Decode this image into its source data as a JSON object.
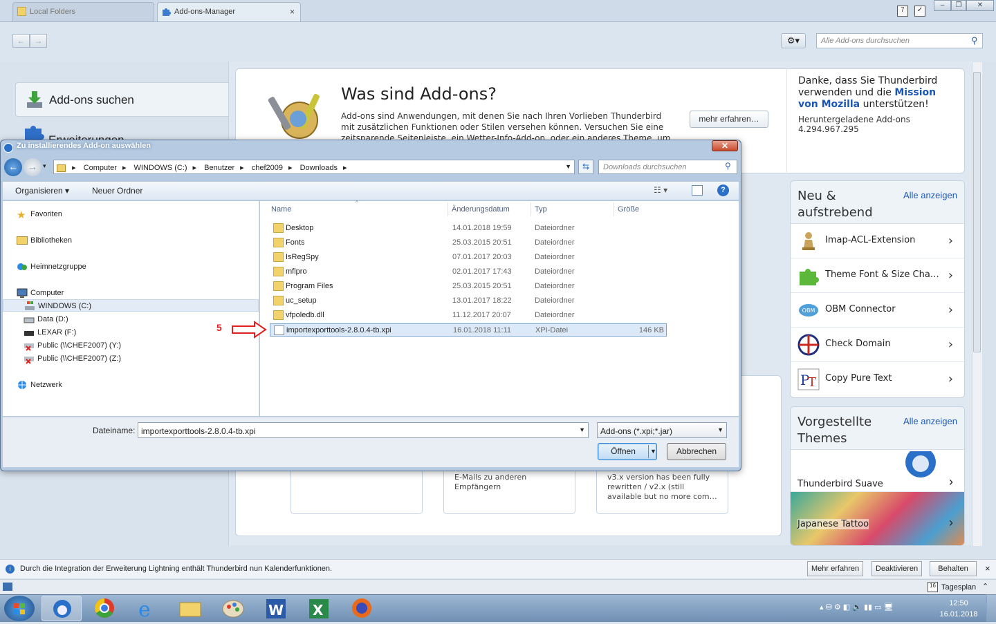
{
  "window": {
    "tabs": [
      {
        "label": "Local Folders"
      },
      {
        "label": "Add-ons-Manager",
        "close": "×"
      }
    ],
    "nav_back": "←",
    "nav_forward": "→",
    "search_placeholder": "Alle Add-ons durchsuchen"
  },
  "sidebar": {
    "items": [
      {
        "label": "Add-ons suchen",
        "icon": "download-icon"
      },
      {
        "label": "Erweiterungen",
        "icon": "puzzle-icon"
      }
    ]
  },
  "whatis": {
    "title": "Was sind Add-ons?",
    "description": "Add-ons sind Anwendungen, mit denen Sie nach Ihren Vorlieben Thunderbird mit zusätzlichen Funktionen oder Stilen versehen können. Versuchen Sie eine zeitsparende Seitenleiste, ein Wetter-Info-Add-on, oder ein anderes Theme, um",
    "more_button": "mehr erfahren…"
  },
  "thanks": {
    "line1": "Danke, dass Sie Thunderbird verwenden und die",
    "link": "Mission von Mozilla",
    "line2": "unterstützen!",
    "downloaded_label": "Heruntergeladene Add-ons",
    "downloaded_count": "4.294.967.295"
  },
  "rising": {
    "title": "Neu & aufstrebend",
    "show_all": "Alle anzeigen",
    "items": [
      {
        "label": "Imap-ACL-Extension",
        "icon": "chess-pawn-icon"
      },
      {
        "label": "Theme Font & Size Cha…",
        "icon": "puzzle-green-icon"
      },
      {
        "label": "OBM Connector",
        "icon": "obm-icon"
      },
      {
        "label": "Check Domain",
        "icon": "globe-icon"
      },
      {
        "label": "Copy Pure Text",
        "icon": "pt-logo-icon"
      }
    ]
  },
  "themes": {
    "title": "Vorgestellte Themes",
    "show_all": "Alle anzeigen",
    "items": [
      {
        "label": "Thunderbird Suave"
      },
      {
        "label": "Japanese Tattoo"
      }
    ]
  },
  "cards": [
    {
      "text": ""
    },
    {
      "text": "E-Mails zu anderen Empfängern"
    },
    {
      "text": "v3.x version has been fully rewritten / v2.x (still available but no more com…"
    }
  ],
  "notification": {
    "text": "Durch die Integration der Erweiterung Lightning enthält Thunderbird nun Kalenderfunktionen.",
    "buttons": [
      "Mehr erfahren",
      "Deaktivieren",
      "Behalten"
    ],
    "close": "×"
  },
  "statusbar": {
    "today_pane": "Tagesplan",
    "calendar_day": "16"
  },
  "taskbar": {
    "time": "12:50",
    "date": "16.01.2018"
  },
  "dialog": {
    "title": "Zu installierendes Add-on auswählen",
    "breadcrumbs": [
      "Computer",
      "WINDOWS (C:)",
      "Benutzer",
      "chef2009",
      "Downloads"
    ],
    "search_placeholder": "Downloads durchsuchen",
    "toolbar": {
      "organize": "Organisieren",
      "new_folder": "Neuer Ordner"
    },
    "tree": {
      "favorites": "Favoriten",
      "libraries": "Bibliotheken",
      "homegroup": "Heimnetzgruppe",
      "computer": "Computer",
      "drives": [
        "WINDOWS (C:)",
        "Data (D:)",
        "LEXAR (F:)",
        "Public (\\\\CHEF2007) (Y:)",
        "Public (\\\\CHEF2007) (Z:)"
      ],
      "network": "Netzwerk"
    },
    "columns": {
      "name": "Name",
      "date": "Änderungsdatum",
      "type": "Typ",
      "size": "Größe"
    },
    "files": [
      {
        "name": "Desktop",
        "date": "14.01.2018 19:59",
        "type": "Dateiordner",
        "size": ""
      },
      {
        "name": "Fonts",
        "date": "25.03.2015 20:51",
        "type": "Dateiordner",
        "size": ""
      },
      {
        "name": "IsRegSpy",
        "date": "07.01.2017 20:03",
        "type": "Dateiordner",
        "size": ""
      },
      {
        "name": "mflpro",
        "date": "02.01.2017 17:43",
        "type": "Dateiordner",
        "size": ""
      },
      {
        "name": "Program Files",
        "date": "25.03.2015 20:51",
        "type": "Dateiordner",
        "size": ""
      },
      {
        "name": "uc_setup",
        "date": "13.01.2017 18:22",
        "type": "Dateiordner",
        "size": ""
      },
      {
        "name": "vfpoledb.dll",
        "date": "11.12.2017 20:07",
        "type": "Dateiordner",
        "size": ""
      },
      {
        "name": "importexporttools-2.8.0.4-tb.xpi",
        "date": "16.01.2018 11:11",
        "type": "XPI-Datei",
        "size": "146 KB"
      }
    ],
    "annotation": "5",
    "filename_label": "Dateiname:",
    "filename_value": "importexporttools-2.8.0.4-tb.xpi",
    "filter": "Add-ons (*.xpi;*.jar)",
    "open_button": "Öffnen",
    "cancel_button": "Abbrechen"
  },
  "colors": {
    "accent": "#1a56b8",
    "annotation": "#e02020",
    "selection": "#dce9f8"
  }
}
